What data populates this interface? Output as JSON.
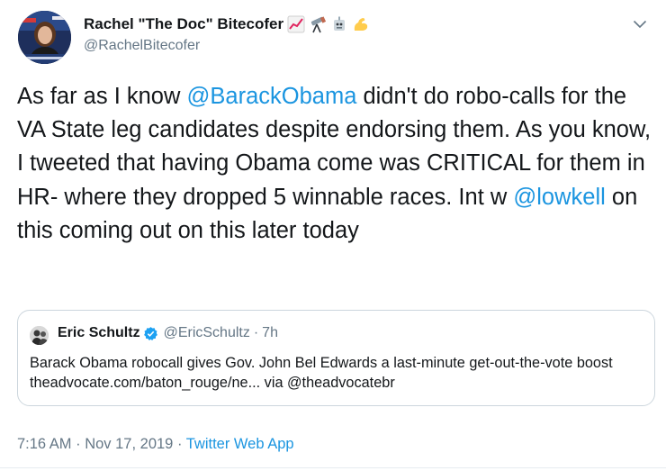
{
  "author": {
    "name": "Rachel \"The Doc\" Bitecofer",
    "handle": "@RachelBitecofer",
    "name_emojis": [
      "chart-increasing-icon",
      "telescope-icon",
      "robot-icon",
      "flexed-biceps-icon"
    ]
  },
  "tweet": {
    "text_parts": [
      {
        "type": "text",
        "value": "As far as I know "
      },
      {
        "type": "mention",
        "value": "@BarackObama"
      },
      {
        "type": "text",
        "value": " didn't do robo-calls for the VA State leg candidates despite endorsing them. As you know, I tweeted that having Obama come was CRITICAL for them in HR- where they dropped 5 winnable races. Int w "
      },
      {
        "type": "mention",
        "value": "@lowkell"
      },
      {
        "type": "text",
        "value": " on this coming out on this later today"
      }
    ]
  },
  "quoted_tweet": {
    "name": "Eric Schultz",
    "handle": "@EricSchultz",
    "separator": "·",
    "time": "7h",
    "text": "Barack Obama robocall gives Gov. John Bel Edwards a last-minute get-out-the-vote boost theadvocate.com/baton_rouge/ne... via @theadvocatebr"
  },
  "footer": {
    "timestamp": "7:16 AM · Nov 17, 2019 · ",
    "source": "Twitter Web App"
  },
  "colors": {
    "link": "#1b95e0",
    "secondary_text": "#657786",
    "primary_text": "#14171a",
    "border": "#ccd6dd",
    "verified": "#1da1f2"
  }
}
